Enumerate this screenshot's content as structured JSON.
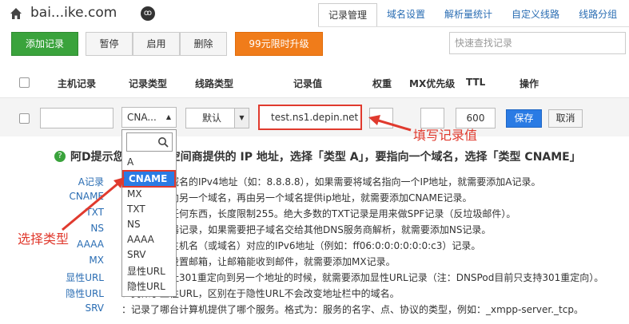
{
  "header": {
    "domain": "bai...ike.com",
    "lock_glyph": "ꝏ"
  },
  "tabs": [
    "记录管理",
    "域名设置",
    "解析量统计",
    "自定义线路",
    "线路分组"
  ],
  "toolbar": {
    "add": "添加记录",
    "pause": "暂停",
    "enable": "启用",
    "delete": "删除",
    "upgrade": "99元限时升级",
    "search_placeholder": "快速查找记录"
  },
  "columns": {
    "host": "主机记录",
    "type": "记录类型",
    "line": "线路类型",
    "value": "记录值",
    "weight": "权重",
    "mx": "MX优先级",
    "ttl": "TTL",
    "action": "操作"
  },
  "edit_row": {
    "type": "CNA...",
    "line": "默认",
    "value": "test.ns1.depin.net",
    "ttl": "600",
    "save": "保存",
    "cancel": "取消"
  },
  "tip": {
    "title": "阿D提示您：要指向空间商提供的 IP 地址，选择「类型 A」，要指向一个域名，选择「类型 CNAME」"
  },
  "types": [
    {
      "label": "A记录",
      "desc": "：用来指定域名的IPv4地址（如：8.8.8.8），如果需要将域名指向一个IP地址，就需要添加A记录。"
    },
    {
      "label": "CNAME",
      "desc": "：将域名指向另一个域名，再由另一个域名提供ip地址，就需要添加CNAME记录。"
    },
    {
      "label": "TXT",
      "desc": "：可以填写任何东西，长度限制255。绝大多数的TXT记录是用来做SPF记录（反垃圾邮件）。"
    },
    {
      "label": "NS",
      "desc": "：域名服务器记录，如果需要把子域名交给其他DNS服务商解析，就需要添加NS记录。"
    },
    {
      "label": "AAAA",
      "desc": "：用来指定主机名（或域名）对应的IPv6地址（例如：ff06:0:0:0:0:0:0:c3）记录。"
    },
    {
      "label": "MX",
      "desc": "：如果需要设置邮箱，让邮箱能收到邮件，就需要添加MX记录。"
    },
    {
      "label": "显性URL",
      "desc": "：从一个地址301重定向到另一个地址的时候，就需要添加显性URL记录（注：DNSPod目前只支持301重定向）。"
    },
    {
      "label": "隐性URL",
      "desc": "：类似于显性URL，区别在于隐性URL不会改变地址栏中的域名。"
    },
    {
      "label": "SRV",
      "desc": "：记录了哪台计算机提供了哪个服务。格式为：服务的名字、点、协议的类型，例如：_xmpp-server._tcp。"
    }
  ],
  "dropdown": {
    "items": [
      "A",
      "CNAME",
      "MX",
      "TXT",
      "NS",
      "AAAA",
      "SRV",
      "显性URL",
      "隐性URL"
    ],
    "selected": "CNAME"
  },
  "annotations": {
    "fill_value": "填写记录值",
    "choose_type": "选择类型"
  },
  "colors": {
    "accent": "#2a7be4",
    "green": "#3aa33c",
    "orange": "#f07c1a",
    "annotation": "#e03a2e"
  }
}
